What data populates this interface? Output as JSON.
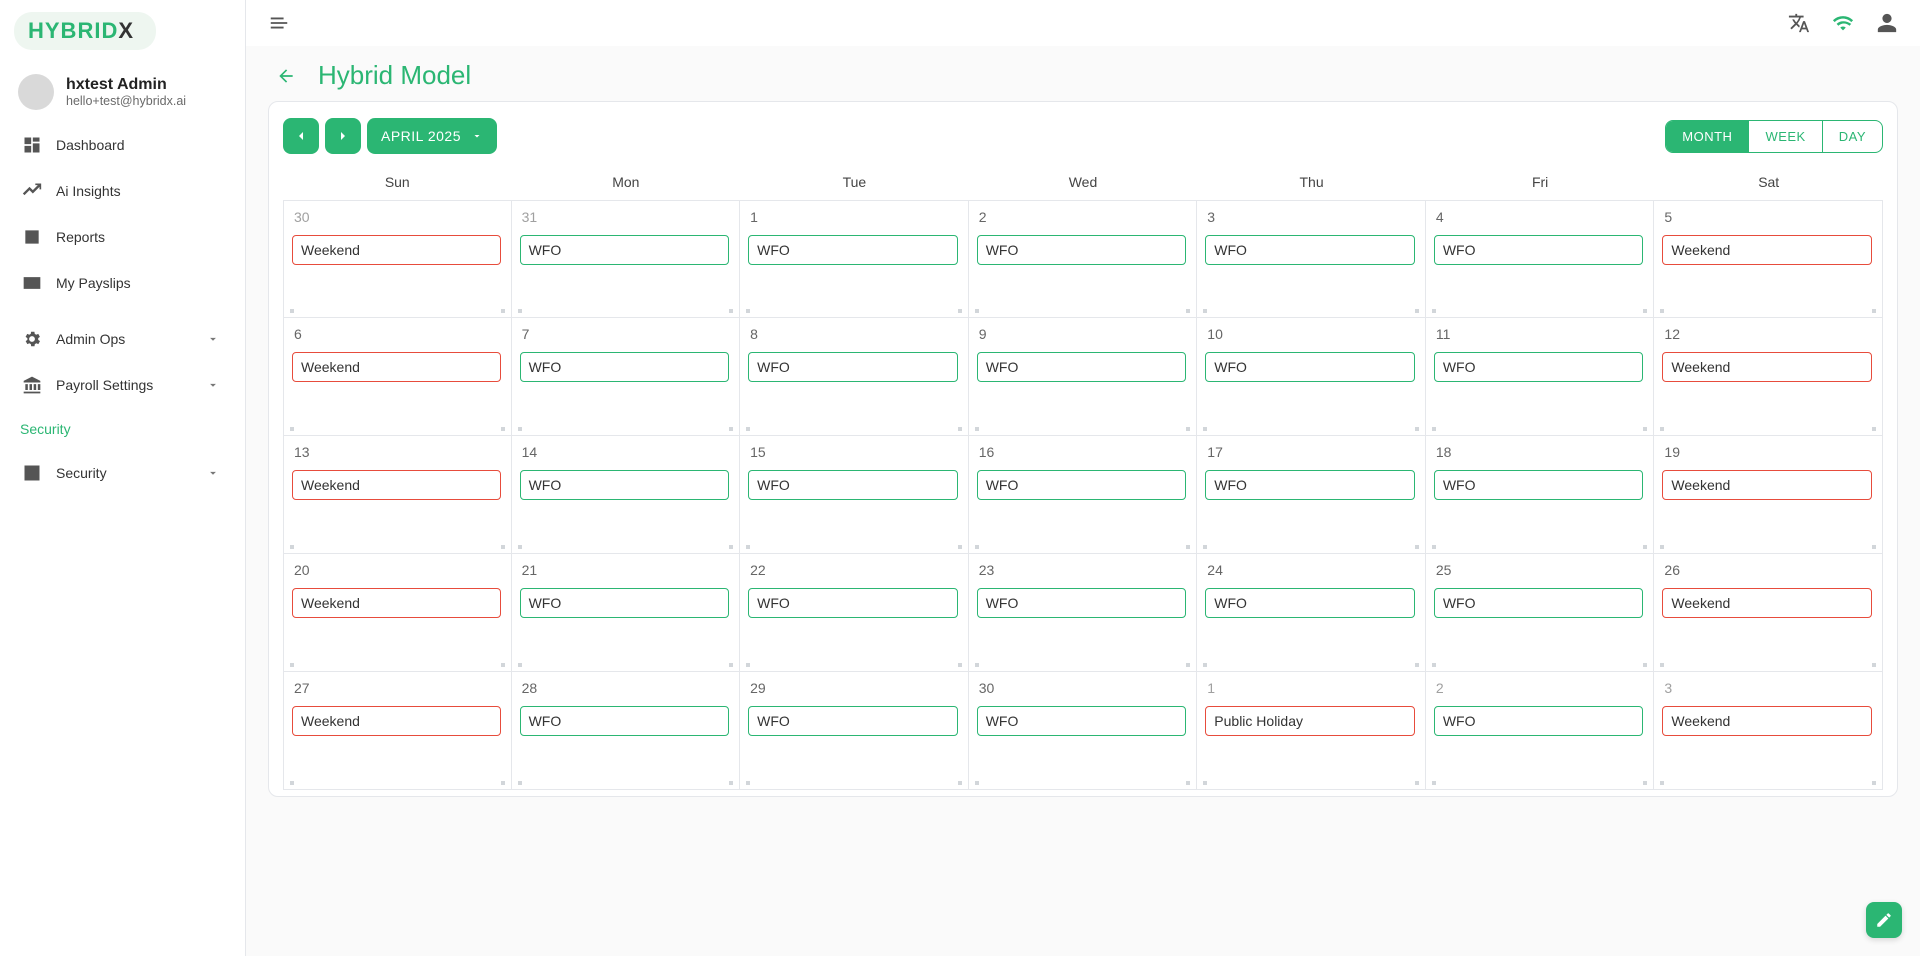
{
  "brand": {
    "name": "HYBRID",
    "suffix": "X"
  },
  "user": {
    "name": "hxtest Admin",
    "email": "hello+test@hybridx.ai"
  },
  "nav": {
    "items": [
      {
        "label": "Dashboard",
        "icon": "dashboard-icon"
      },
      {
        "label": "Ai Insights",
        "icon": "insights-icon"
      },
      {
        "label": "Reports",
        "icon": "reports-icon"
      },
      {
        "label": "My Payslips",
        "icon": "payslips-icon"
      },
      {
        "label": "Admin Ops",
        "icon": "gear-icon",
        "expandable": true
      },
      {
        "label": "Payroll Settings",
        "icon": "bank-icon",
        "expandable": true
      },
      {
        "label": "Security",
        "active": true
      },
      {
        "label": "Security",
        "icon": "plus-box-icon",
        "expandable": true
      }
    ]
  },
  "page": {
    "title": "Hybrid Model"
  },
  "calendar": {
    "label": "APRIL 2025",
    "view_options": [
      "MONTH",
      "WEEK",
      "DAY"
    ],
    "active_view": "MONTH",
    "weekdays": [
      "Sun",
      "Mon",
      "Tue",
      "Wed",
      "Thu",
      "Fri",
      "Sat"
    ],
    "cells": [
      {
        "d": "30",
        "other": true,
        "ev": "Weekend",
        "t": "red"
      },
      {
        "d": "31",
        "other": true,
        "ev": "WFO",
        "t": "green"
      },
      {
        "d": "1",
        "ev": "WFO",
        "t": "green"
      },
      {
        "d": "2",
        "ev": "WFO",
        "t": "green"
      },
      {
        "d": "3",
        "ev": "WFO",
        "t": "green"
      },
      {
        "d": "4",
        "ev": "WFO",
        "t": "green"
      },
      {
        "d": "5",
        "ev": "Weekend",
        "t": "red"
      },
      {
        "d": "6",
        "ev": "Weekend",
        "t": "red"
      },
      {
        "d": "7",
        "ev": "WFO",
        "t": "green"
      },
      {
        "d": "8",
        "ev": "WFO",
        "t": "green"
      },
      {
        "d": "9",
        "ev": "WFO",
        "t": "green"
      },
      {
        "d": "10",
        "ev": "WFO",
        "t": "green"
      },
      {
        "d": "11",
        "ev": "WFO",
        "t": "green"
      },
      {
        "d": "12",
        "ev": "Weekend",
        "t": "red"
      },
      {
        "d": "13",
        "ev": "Weekend",
        "t": "red"
      },
      {
        "d": "14",
        "ev": "WFO",
        "t": "green"
      },
      {
        "d": "15",
        "ev": "WFO",
        "t": "green"
      },
      {
        "d": "16",
        "ev": "WFO",
        "t": "green"
      },
      {
        "d": "17",
        "ev": "WFO",
        "t": "green"
      },
      {
        "d": "18",
        "ev": "WFO",
        "t": "green"
      },
      {
        "d": "19",
        "ev": "Weekend",
        "t": "red"
      },
      {
        "d": "20",
        "ev": "Weekend",
        "t": "red"
      },
      {
        "d": "21",
        "ev": "WFO",
        "t": "green"
      },
      {
        "d": "22",
        "ev": "WFO",
        "t": "green"
      },
      {
        "d": "23",
        "ev": "WFO",
        "t": "green"
      },
      {
        "d": "24",
        "ev": "WFO",
        "t": "green"
      },
      {
        "d": "25",
        "ev": "WFO",
        "t": "green"
      },
      {
        "d": "26",
        "ev": "Weekend",
        "t": "red"
      },
      {
        "d": "27",
        "ev": "Weekend",
        "t": "red"
      },
      {
        "d": "28",
        "ev": "WFO",
        "t": "green"
      },
      {
        "d": "29",
        "ev": "WFO",
        "t": "green"
      },
      {
        "d": "30",
        "ev": "WFO",
        "t": "green"
      },
      {
        "d": "1",
        "other": true,
        "ev": "Public Holiday",
        "t": "red"
      },
      {
        "d": "2",
        "other": true,
        "ev": "WFO",
        "t": "green"
      },
      {
        "d": "3",
        "other": true,
        "ev": "Weekend",
        "t": "red"
      }
    ]
  }
}
